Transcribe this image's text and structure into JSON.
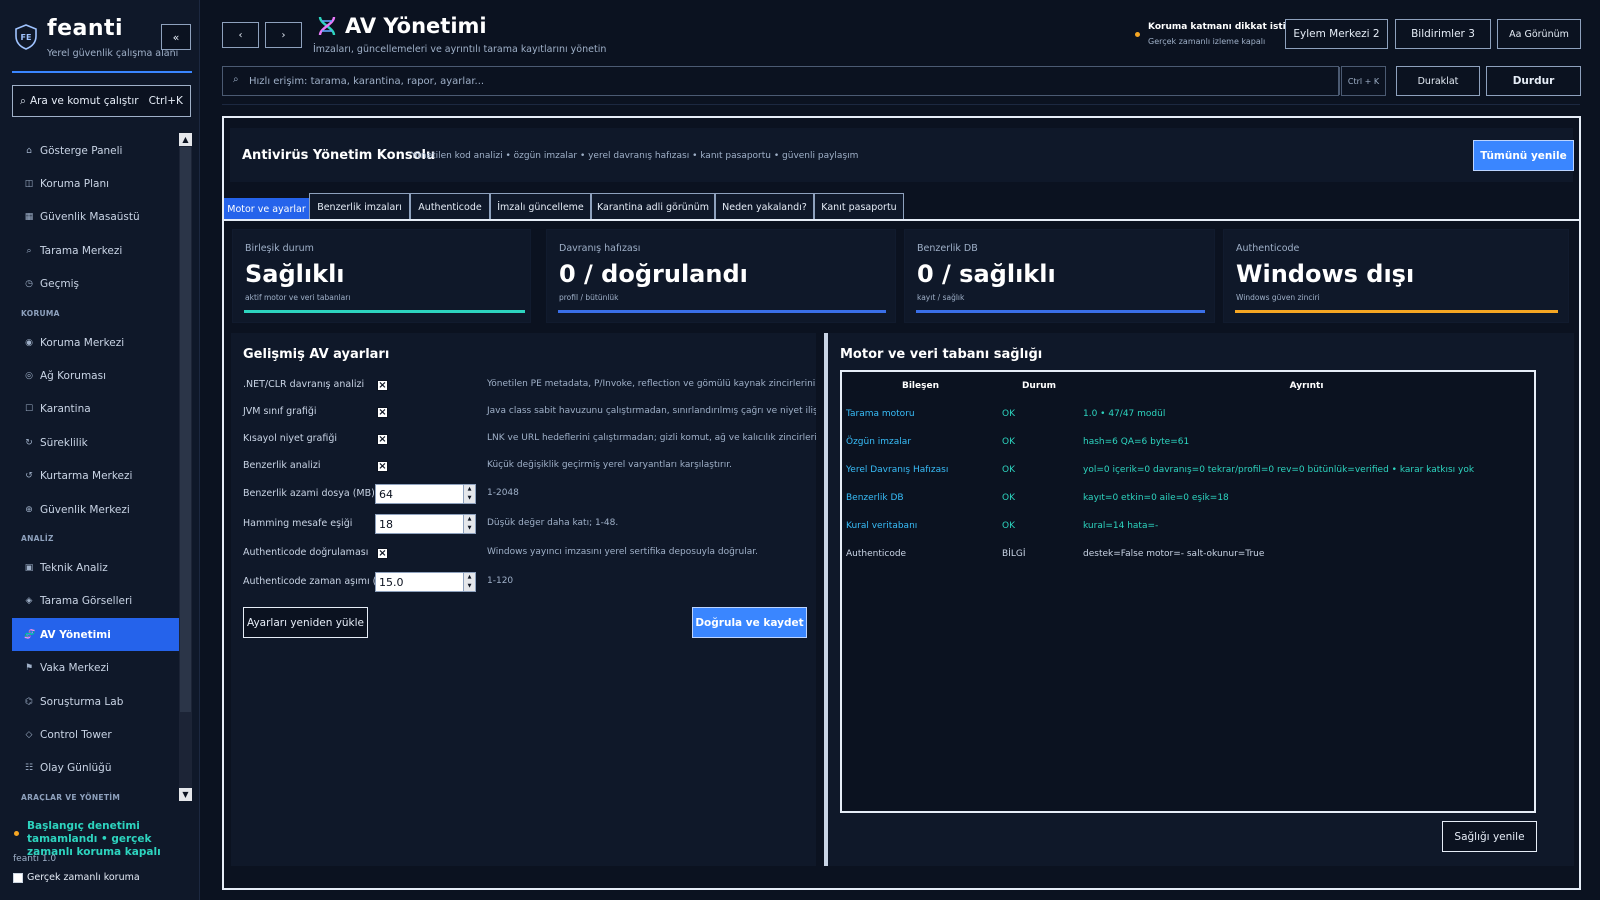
{
  "sidebar": {
    "brand_name": "feanti",
    "brand_logo": "FE",
    "brand_sub": "Yerel güvenlik çalışma alanı",
    "collapse_label": "«",
    "command_label": "Ara ve komut çalıştır",
    "command_shortcut": "Ctrl+K",
    "sections": {
      "koruma": "KORUMA",
      "analiz": "ANALİZ",
      "araclar": "ARAÇLAR VE YÖNETİM"
    },
    "items": [
      {
        "label": "Gösterge Paneli",
        "icon": "home-icon"
      },
      {
        "label": "Koruma Planı",
        "icon": "layout-icon"
      },
      {
        "label": "Güvenlik Masaüstü",
        "icon": "grid-icon"
      },
      {
        "label": "Tarama Merkezi",
        "icon": "search-icon"
      },
      {
        "label": "Geçmiş",
        "icon": "clock-icon"
      },
      {
        "label": "Koruma Merkezi",
        "icon": "shield-icon"
      },
      {
        "label": "Ağ Koruması",
        "icon": "network-icon"
      },
      {
        "label": "Karantina",
        "icon": "box-icon"
      },
      {
        "label": "Süreklilik",
        "icon": "refresh-icon"
      },
      {
        "label": "Kurtarma Merkezi",
        "icon": "restore-icon"
      },
      {
        "label": "Güvenlik Merkezi",
        "icon": "target-icon"
      },
      {
        "label": "Teknik Analiz",
        "icon": "chip-icon"
      },
      {
        "label": "Tarama Görselleri",
        "icon": "diamond-icon"
      },
      {
        "label": "AV Yönetimi",
        "icon": "dna-icon"
      },
      {
        "label": "Vaka Merkezi",
        "icon": "flag-icon"
      },
      {
        "label": "Soruşturma Lab",
        "icon": "lab-icon"
      },
      {
        "label": "Control Tower",
        "icon": "tower-icon"
      },
      {
        "label": "Olay Günlüğü",
        "icon": "list-icon"
      }
    ],
    "status_text": "Başlangıç denetimi tamamlandı • gerçek zamanlı koruma kapalı",
    "version": "feanti 1.0",
    "realtime_label": "Gerçek zamanlı koruma"
  },
  "header": {
    "back_label": "‹",
    "forward_label": "›",
    "title": "AV Yönetimi",
    "subtitle": "İmzaları, güncellemeleri ve ayrıntılı tarama kayıtlarını yönetin",
    "alert_title": "Koruma katmanı dikkat istiyor",
    "alert_sub": "Gerçek zamanlı izleme kapalı",
    "action_center": "Eylem Merkezi  2",
    "notifications": "Bildirimler 3",
    "view": "Aa Görünüm",
    "search_placeholder": "Hızlı erişim: tarama, karantina, rapor, ayarlar...",
    "search_shortcut": "Ctrl + K",
    "pause": "Duraklat",
    "stop": "Durdur"
  },
  "console": {
    "title": "Antivirüs Yönetim Konsolu",
    "subtitle": "Yönetilen kod analizi • özgün imzalar • yerel davranış hafızası • kanıt pasaportu • güvenli paylaşım",
    "refresh_all": "Tümünü yenile",
    "tabs": [
      "Motor ve ayarlar",
      "Benzerlik imzaları",
      "Authenticode",
      "İmzalı güncelleme",
      "Karantina adli görünüm",
      "Neden yakalandı?",
      "Kanıt pasaportu"
    ],
    "cards": [
      {
        "label": "Birleşik durum",
        "value": "Sağlıklı",
        "sub": "aktif motor ve veri tabanları",
        "color": "#2dd4bf"
      },
      {
        "label": "Davranış hafızası",
        "value": "0 / doğrulandı",
        "sub": "profil / bütünlük",
        "color": "#3a6fe8"
      },
      {
        "label": "Benzerlik DB",
        "value": "0 / sağlıklı",
        "sub": "kayıt / sağlık",
        "color": "#3a6fe8"
      },
      {
        "label": "Authenticode",
        "value": "Windows dışı",
        "sub": "Windows güven zinciri",
        "color": "#f5a623"
      }
    ]
  },
  "settings": {
    "title": "Gelişmiş AV ayarları",
    "rows": [
      {
        "label": ".NET/CLR davranış analizi",
        "checked": true,
        "desc": "Yönetilen PE metadata, P/Invoke, reflection ve gömülü kaynak zincirlerini bütçel"
      },
      {
        "label": "JVM sınıf grafiği",
        "checked": true,
        "desc": "Java class sabit havuzunu çalıştırmadan, sınırlandırılmış çağrı ve niyet ilişkileriyle"
      },
      {
        "label": "Kısayol niyet grafiği",
        "checked": true,
        "desc": "LNK ve URL hedeflerini çalıştırmadan; gizli komut, ağ ve kalıcılık zincirleri ilişki"
      },
      {
        "label": "Benzerlik analizi",
        "checked": true,
        "desc": "Küçük değişiklik geçirmiş yerel varyantları karşılaştırır."
      },
      {
        "label": "Benzerlik azami dosya (MB)",
        "value": "64",
        "desc": "1-2048"
      },
      {
        "label": "Hamming mesafe eşiği",
        "value": "18",
        "desc": "Düşük değer daha katı; 1-48."
      },
      {
        "label": "Authenticode doğrulaması",
        "checked": true,
        "desc": "Windows yayıncı imzasını yerel sertifika deposuyla doğrular."
      },
      {
        "label": "Authenticode zaman aşımı (sn)",
        "value": "15.0",
        "desc": "1-120"
      }
    ],
    "reload": "Ayarları yeniden yükle",
    "save": "Doğrula ve kaydet"
  },
  "health": {
    "title": "Motor ve veri tabanı sağlığı",
    "columns": [
      "Bileşen",
      "Durum",
      "Ayrıntı"
    ],
    "rows": [
      {
        "component": "Tarama motoru",
        "status": "OK",
        "detail": "1.0 • 47/47 modül",
        "tone": "ok"
      },
      {
        "component": "Özgün imzalar",
        "status": "OK",
        "detail": "hash=6 QA=6 byte=61",
        "tone": "ok"
      },
      {
        "component": "Yerel Davranış Hafızası",
        "status": "OK",
        "detail": "yol=0 içerik=0 davranış=0 tekrar/profil=0 rev=0 bütünlük=verified • karar katkısı yok",
        "tone": "ok"
      },
      {
        "component": "Benzerlik DB",
        "status": "OK",
        "detail": "kayıt=0 etkin=0 aile=0 eşik=18",
        "tone": "ok"
      },
      {
        "component": "Kural veritabanı",
        "status": "OK",
        "detail": "kural=14 hata=-",
        "tone": "ok"
      },
      {
        "component": "Authenticode",
        "status": "BİLGİ",
        "detail": "destek=False motor=- salt-okunur=True",
        "tone": "info"
      }
    ],
    "refresh": "Sağlığı yenile"
  },
  "colors": {
    "background": "#0b1220",
    "panel": "#0f1829",
    "accent": "#3a86ff",
    "ok": "#2dd4bf",
    "warning": "#f5a623",
    "link": "#38bdf8"
  }
}
